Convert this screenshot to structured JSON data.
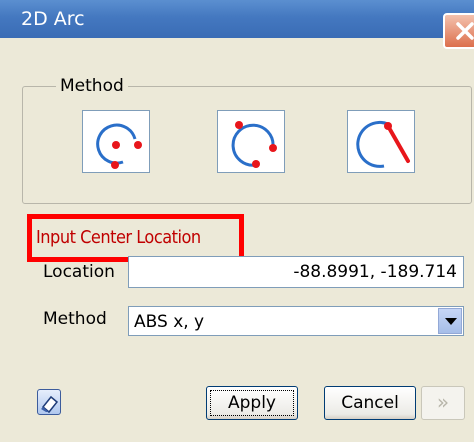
{
  "window": {
    "title": "2D Arc"
  },
  "method_group": {
    "legend": "Method",
    "buttons": [
      {
        "name": "center-start-end",
        "icon": "arc-center-icon"
      },
      {
        "name": "three-point",
        "icon": "arc-three-point-icon"
      },
      {
        "name": "start-end-tangent",
        "icon": "arc-tangent-icon"
      }
    ]
  },
  "prompt": {
    "text": "Input Center Location"
  },
  "location": {
    "label": "Location",
    "value": "-88.8991, -189.714"
  },
  "method_select": {
    "label": "Method",
    "value": "ABS x, y"
  },
  "footer": {
    "apply_label": "Apply",
    "cancel_label": "Cancel",
    "more_label": "»"
  },
  "colors": {
    "titlebar": "#4478c0",
    "dialog_bg": "#ece9d8",
    "arc_stroke": "#2a6fc9",
    "point": "#e8161b",
    "prompt_text": "#c00000",
    "highlight_border": "#ff0000"
  }
}
